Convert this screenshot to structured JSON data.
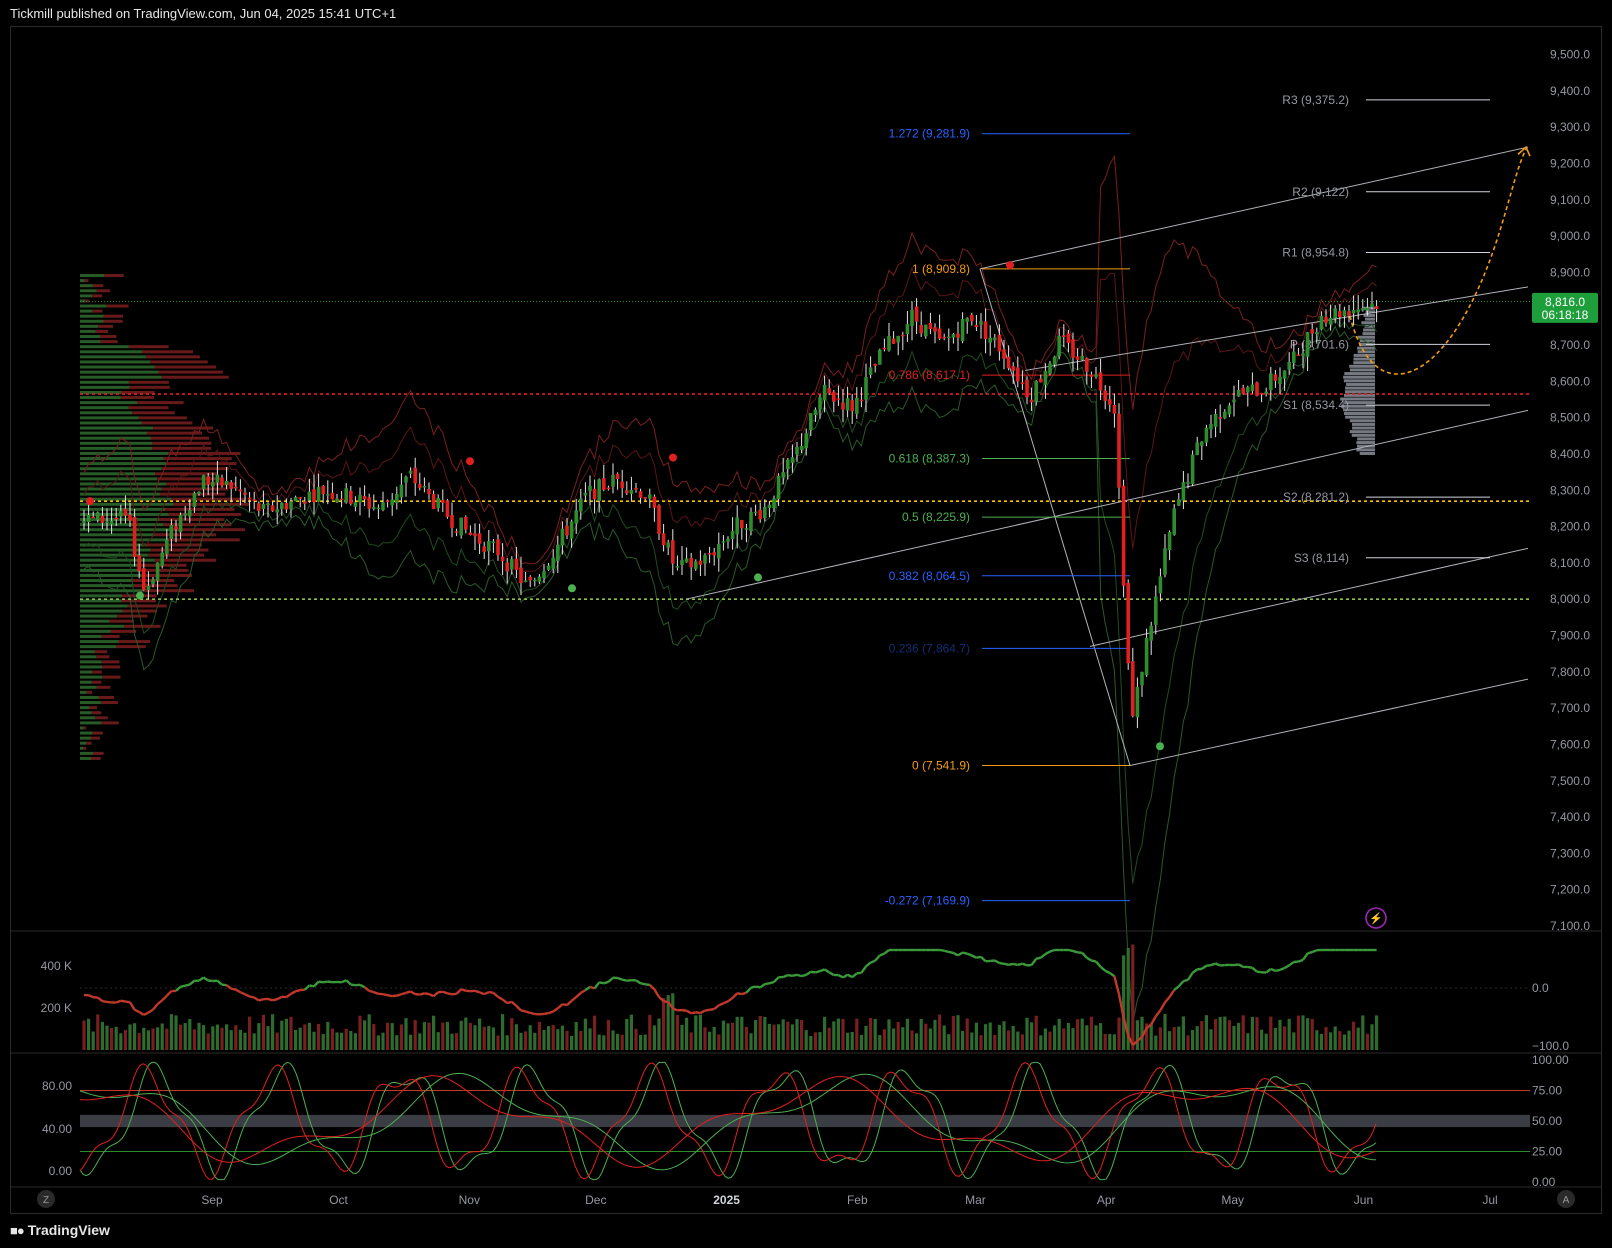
{
  "header": {
    "publisher": "Tickmill published on TradingView.com, Jun 04, 2025 15:41 UTC+1"
  },
  "footer": {
    "brand": "TradingView",
    "logo_icon": "tradingview-logo-icon"
  },
  "colors": {
    "up": "#2e8b2e",
    "down": "#e0201f",
    "fib_orange": "#f39c12",
    "fib_blue": "#2962ff",
    "price_tag": "#1e9e3a"
  },
  "chart_data": [
    {
      "type": "candlestick",
      "panel": "price",
      "x_axis": {
        "labels": [
          "Sep",
          "Oct",
          "Nov",
          "Dec",
          "2025",
          "Feb",
          "Mar",
          "Apr",
          "May",
          "Jun",
          "Jul"
        ]
      },
      "y_axis": {
        "labels": [
          "9,500.0",
          "9,400.0",
          "9,300.0",
          "9,200.0",
          "9,100.0",
          "9,000.0",
          "8,900.0",
          "8,800.0",
          "8,700.0",
          "8,600.0",
          "8,500.0",
          "8,400.0",
          "8,300.0",
          "8,200.0",
          "8,100.0",
          "8,000.0",
          "7,900.0",
          "7,800.0",
          "7,700.0",
          "7,600.0",
          "7,500.0",
          "7,400.0",
          "7,300.0",
          "7,200.0",
          "7,100.0"
        ],
        "range": [
          7100,
          9550
        ]
      },
      "last_price": {
        "value": "8,816.0",
        "countdown": "06:18:18"
      },
      "close_path": [
        [
          "2024-08-12",
          8220
        ],
        [
          "2024-08-16",
          8020
        ],
        [
          "2024-08-23",
          8200
        ],
        [
          "2024-08-30",
          8330
        ],
        [
          "2024-09-06",
          8310
        ],
        [
          "2024-09-13",
          8240
        ],
        [
          "2024-09-20",
          8270
        ],
        [
          "2024-09-27",
          8300
        ],
        [
          "2024-10-04",
          8280
        ],
        [
          "2024-10-11",
          8250
        ],
        [
          "2024-10-18",
          8340
        ],
        [
          "2024-10-25",
          8250
        ],
        [
          "2024-11-01",
          8180
        ],
        [
          "2024-11-08",
          8130
        ],
        [
          "2024-11-15",
          8030
        ],
        [
          "2024-11-22",
          8150
        ],
        [
          "2024-11-29",
          8290
        ],
        [
          "2024-12-06",
          8330
        ],
        [
          "2024-12-13",
          8290
        ],
        [
          "2024-12-20",
          8080
        ],
        [
          "2024-12-27",
          8110
        ],
        [
          "2025-01-03",
          8200
        ],
        [
          "2025-01-10",
          8250
        ],
        [
          "2025-01-17",
          8390
        ],
        [
          "2025-01-24",
          8570
        ],
        [
          "2025-01-31",
          8530
        ],
        [
          "2025-02-07",
          8680
        ],
        [
          "2025-02-14",
          8780
        ],
        [
          "2025-02-21",
          8700
        ],
        [
          "2025-02-28",
          8780
        ],
        [
          "2025-03-07",
          8690
        ],
        [
          "2025-03-14",
          8560
        ],
        [
          "2025-03-21",
          8710
        ],
        [
          "2025-03-28",
          8640
        ],
        [
          "2025-04-03",
          8530
        ],
        [
          "2025-04-07",
          7650
        ],
        [
          "2025-04-10",
          7850
        ],
        [
          "2025-04-17",
          8230
        ],
        [
          "2025-04-24",
          8460
        ],
        [
          "2025-05-01",
          8560
        ],
        [
          "2025-05-08",
          8580
        ],
        [
          "2025-05-15",
          8650
        ],
        [
          "2025-05-22",
          8780
        ],
        [
          "2025-05-29",
          8800
        ],
        [
          "2025-06-04",
          8816
        ]
      ],
      "fibonacci": [
        {
          "label": "1.272 (9,281.9)",
          "value": 9281.9
        },
        {
          "label": "1 (8,909.8)",
          "value": 8909.8
        },
        {
          "label": "0.786 (8,617.1)",
          "value": 8617.1
        },
        {
          "label": "0.618 (8,387.3)",
          "value": 8387.3
        },
        {
          "label": "0.5 (8,225.9)",
          "value": 8225.9
        },
        {
          "label": "0.382 (8,064.5)",
          "value": 8064.5
        },
        {
          "label": "0.236 (7,864.7)",
          "value": 7864.7
        },
        {
          "label": "0 (7,541.9)",
          "value": 7541.9
        },
        {
          "label": "-0.272 (7,169.9)",
          "value": 7169.9
        }
      ],
      "pivots": [
        {
          "label": "R3 (9,375.2)",
          "value": 9375.2
        },
        {
          "label": "R2 (9,122)",
          "value": 9122
        },
        {
          "label": "R1 (8,954.8)",
          "value": 8954.8
        },
        {
          "label": "P (8,701.6)",
          "value": 8701.6
        },
        {
          "label": "S1 (8,534.4)",
          "value": 8534.4
        },
        {
          "label": "S2 (8,281.2)",
          "value": 8281.2
        },
        {
          "label": "S3 (8,114)",
          "value": 8114
        }
      ],
      "horizontal_levels": [
        8820,
        8565,
        8270,
        8000
      ]
    },
    {
      "type": "line",
      "panel": "momentum",
      "left_labels": [
        "400 K",
        "200 K"
      ],
      "right_labels": [
        "0.0",
        "−100.0"
      ]
    },
    {
      "type": "line",
      "panel": "stochastic",
      "left_labels": [
        "80.00",
        "40.00",
        "0.00"
      ],
      "right_labels": [
        "100.00",
        "75.00",
        "50.00",
        "25.00",
        "0.00"
      ]
    }
  ],
  "axis_buttons": {
    "left": "Z",
    "right": "A"
  }
}
